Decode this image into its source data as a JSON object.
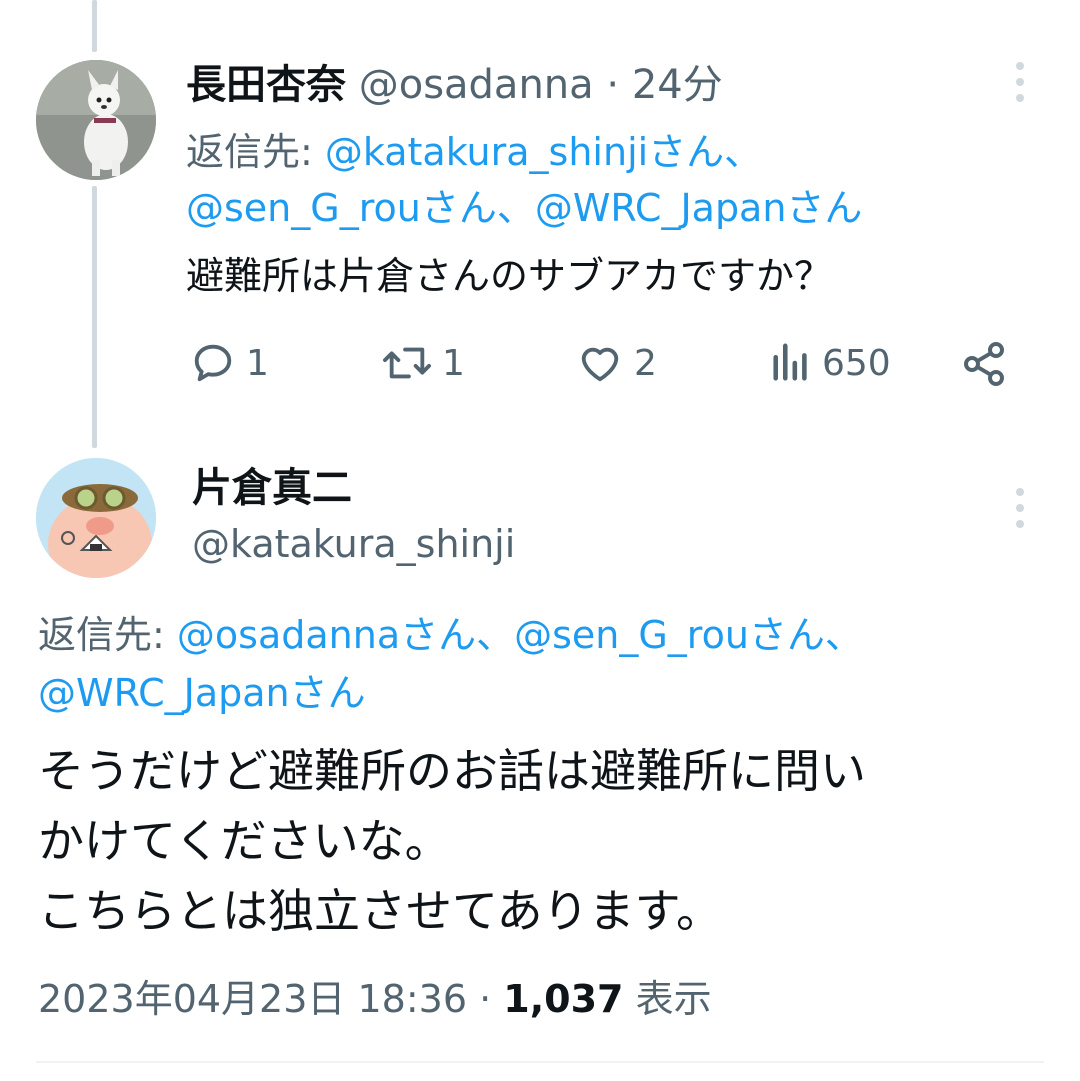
{
  "tweet1": {
    "display_name": "長田杏奈",
    "handle": "@osadanna",
    "separator": "·",
    "time": "24分",
    "reply_label": "返信先:",
    "reply_mentions_line1": "@katakura_shinjiさん、",
    "reply_mentions_line2": "@sen_G_rouさん、@WRC_Japanさん",
    "text": "避難所は片倉さんのサブアカですか？",
    "reply_count": "1",
    "retweet_count": "1",
    "like_count": "2",
    "view_count": "650"
  },
  "tweet2": {
    "display_name": "片倉真二",
    "handle": "@katakura_shinji",
    "reply_label": "返信先:",
    "reply_mentions_line1": "@osadannaさん、@sen_G_rouさん、",
    "reply_mentions_line2": "@WRC_Japanさん",
    "text_line1": "そうだけど避難所のお話は避難所に問い",
    "text_line2": "かけてくださいな。",
    "text_line3": "こちらとは独立させてあります。",
    "timestamp": "2023年04月23日 18:36",
    "separator": "·",
    "views_count": "1,037",
    "views_label": "表示"
  },
  "colors": {
    "link": "#1d9bf0",
    "muted": "#536471",
    "text": "#0f1419",
    "line": "#cfd9de"
  },
  "icons": [
    "reply-icon",
    "retweet-icon",
    "like-icon",
    "views-icon",
    "share-icon",
    "more-icon"
  ]
}
